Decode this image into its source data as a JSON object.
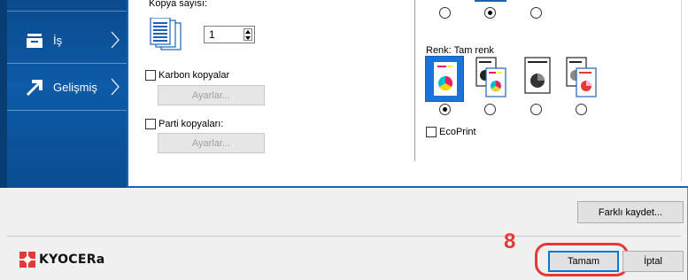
{
  "nav": {
    "items": [
      {
        "label": "İş",
        "icon": "job-icon"
      },
      {
        "label": "Gelişmiş",
        "icon": "advanced-arrow-icon"
      }
    ]
  },
  "copies": {
    "label": "Kopya sayısı:",
    "value": "1"
  },
  "carbon": {
    "label": "Karbon kopyalar",
    "settings_label": "Ayarlar..."
  },
  "batch": {
    "label": "Parti kopyaları:",
    "settings_label": "Ayarlar..."
  },
  "color": {
    "label": "Renk:  Tam renk",
    "selected_index": 0,
    "options": [
      "full-color-icon",
      "auto-color-icon",
      "black-white-icon",
      "single-color-icon"
    ]
  },
  "ecoprint": {
    "label": "EcoPrint"
  },
  "footer": {
    "save_as": "Farklı kaydet...",
    "ok": "Tamam",
    "cancel": "İptal",
    "step_number": "8",
    "logo_text": "KYOCERa"
  },
  "colors": {
    "nav_blue": "#0d5aa6",
    "accent": "#1c63b7",
    "highlight": "#e53935"
  }
}
